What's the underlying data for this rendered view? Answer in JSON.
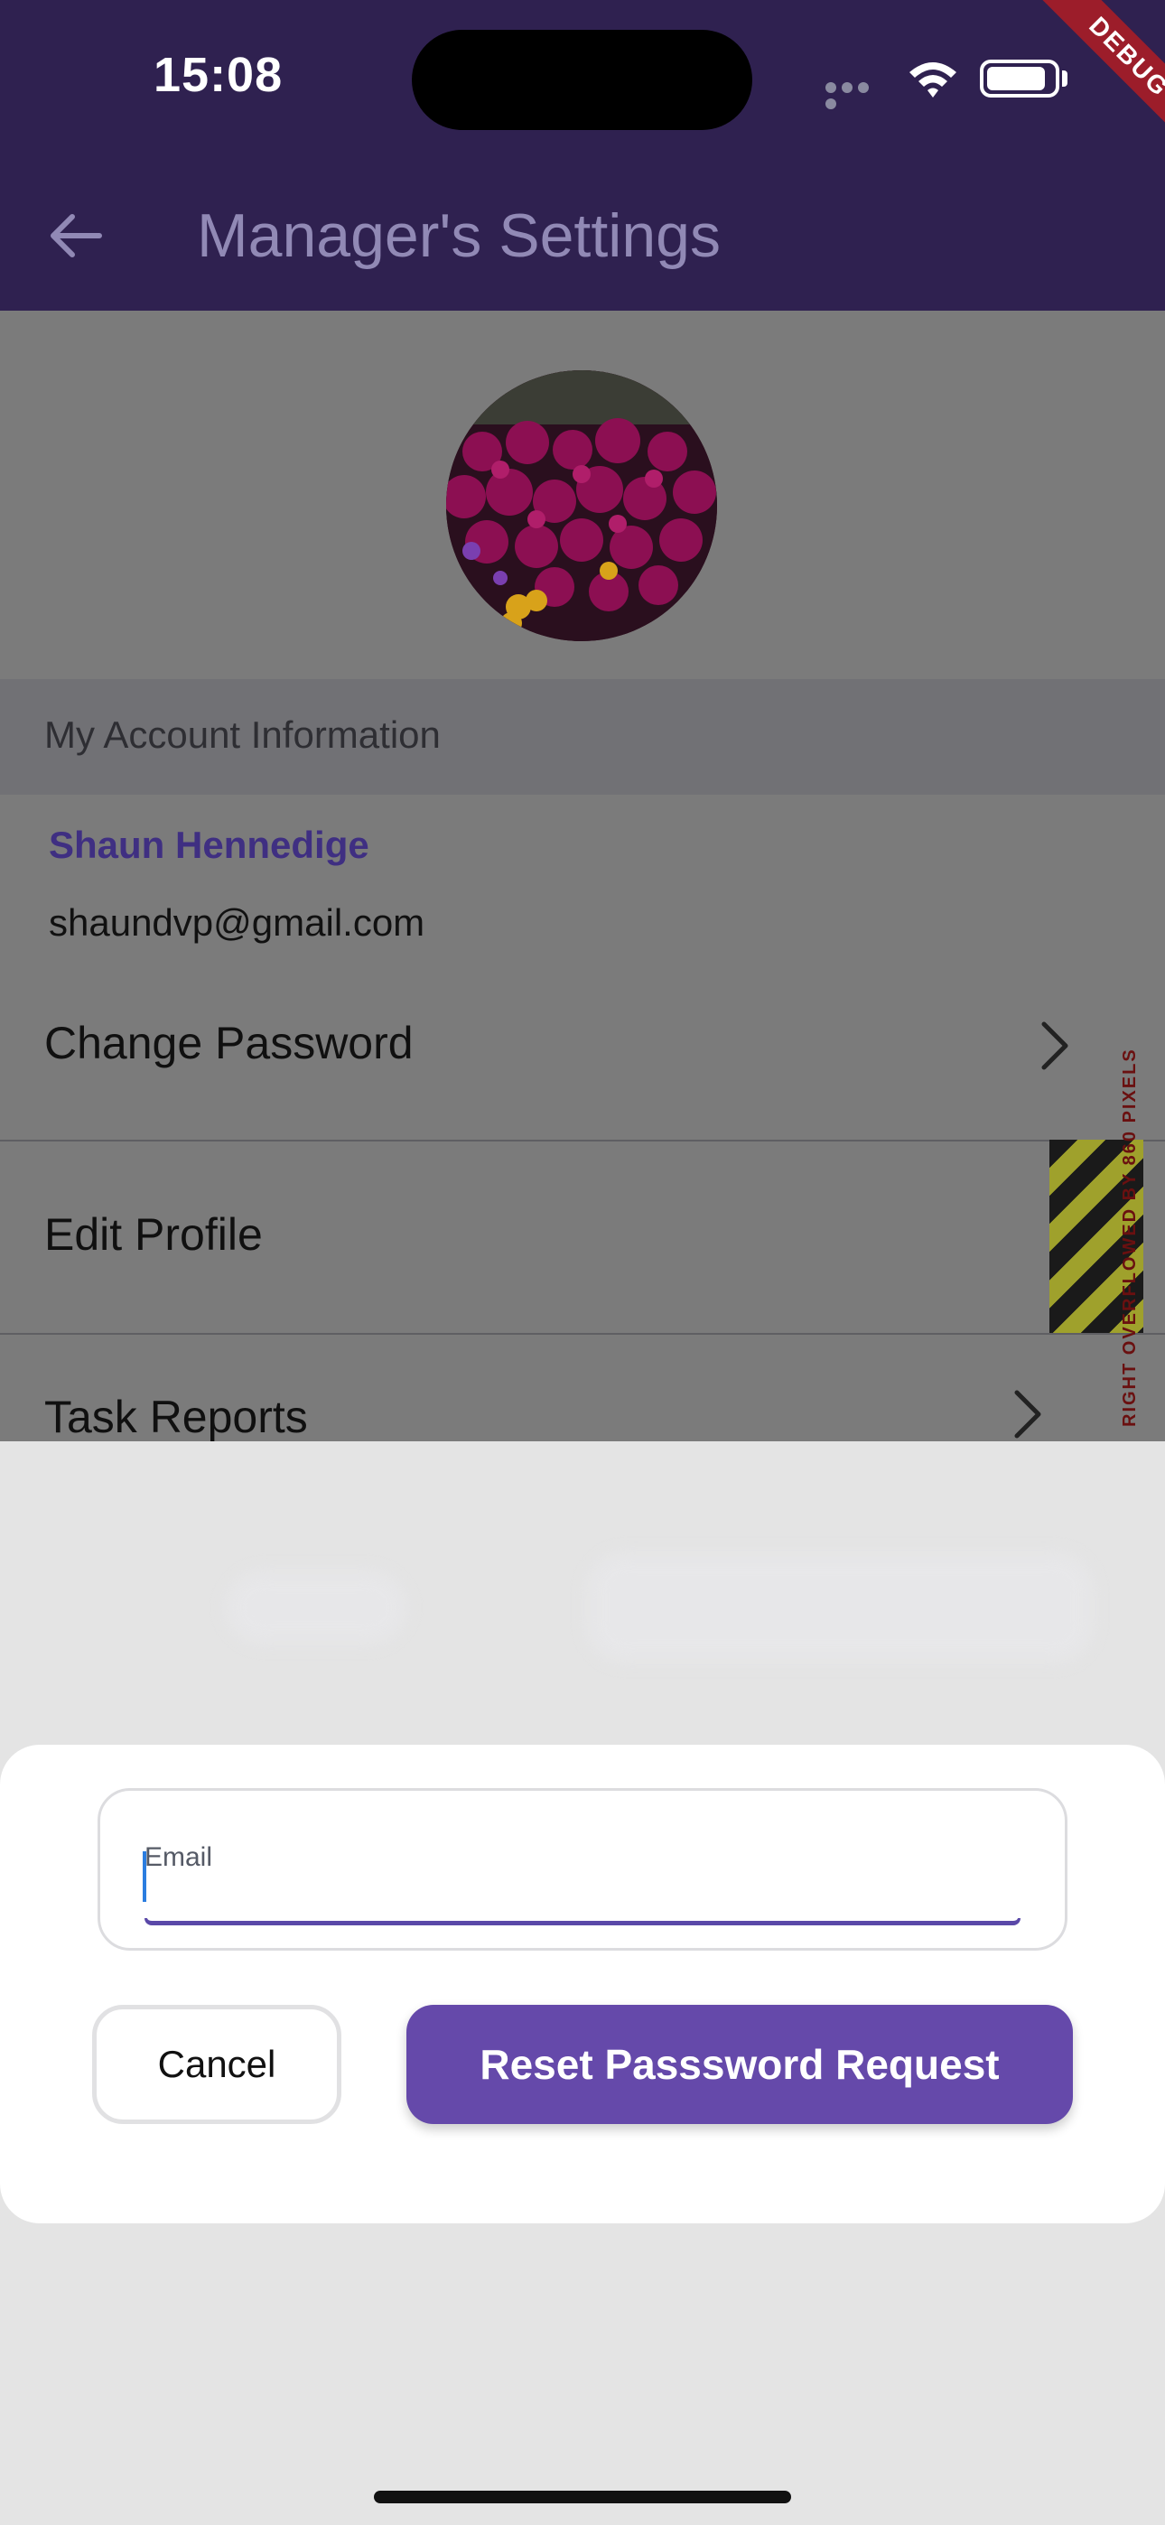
{
  "status_bar": {
    "time": "15:08",
    "debug_banner": "DEBUG"
  },
  "app_bar": {
    "title": "Manager's Settings",
    "back_icon": "arrow-left-icon",
    "background_color": "#2f2150"
  },
  "profile": {
    "avatar_description_icon": "avatar",
    "section_title": "My Account Information",
    "name": "Shaun Hennedige",
    "email": "shaundvp@gmail.com"
  },
  "menu": {
    "items": [
      {
        "label": "Change Password",
        "icon": "chevron-right-icon"
      },
      {
        "label": "Edit Profile",
        "icon": "chevron-right-icon"
      },
      {
        "label": "Task Reports",
        "icon": "chevron-right-icon"
      }
    ]
  },
  "overflow_warning": "RIGHT OVERFLOWED BY 860 PIXELS",
  "dialog": {
    "email_label": "Email",
    "email_value": "",
    "cancel_label": "Cancel",
    "reset_label": "Reset Passsword Request",
    "accent_color": "#6549aa"
  }
}
